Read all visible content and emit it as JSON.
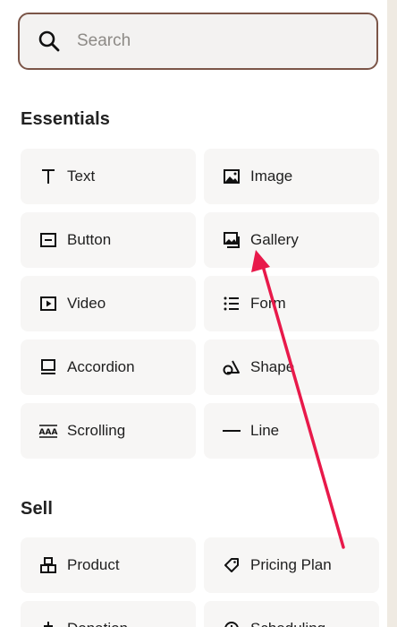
{
  "search": {
    "placeholder": "Search"
  },
  "sections": {
    "essentials": {
      "title": "Essentials",
      "items": [
        {
          "label": "Text",
          "icon": "text-icon"
        },
        {
          "label": "Image",
          "icon": "image-icon"
        },
        {
          "label": "Button",
          "icon": "button-icon"
        },
        {
          "label": "Gallery",
          "icon": "gallery-icon"
        },
        {
          "label": "Video",
          "icon": "video-icon"
        },
        {
          "label": "Form",
          "icon": "form-icon"
        },
        {
          "label": "Accordion",
          "icon": "accordion-icon"
        },
        {
          "label": "Shape",
          "icon": "shape-icon"
        },
        {
          "label": "Scrolling",
          "icon": "scrolling-icon"
        },
        {
          "label": "Line",
          "icon": "line-icon"
        }
      ]
    },
    "sell": {
      "title": "Sell",
      "items": [
        {
          "label": "Product",
          "icon": "product-icon"
        },
        {
          "label": "Pricing Plan",
          "icon": "pricing-plan-icon"
        },
        {
          "label": "Donation",
          "icon": "donation-icon"
        },
        {
          "label": "Scheduling",
          "icon": "scheduling-icon"
        }
      ]
    }
  },
  "colors": {
    "search_border": "#7b5548",
    "tile_bg": "#f7f6f5",
    "annotation_arrow": "#e8194a"
  }
}
